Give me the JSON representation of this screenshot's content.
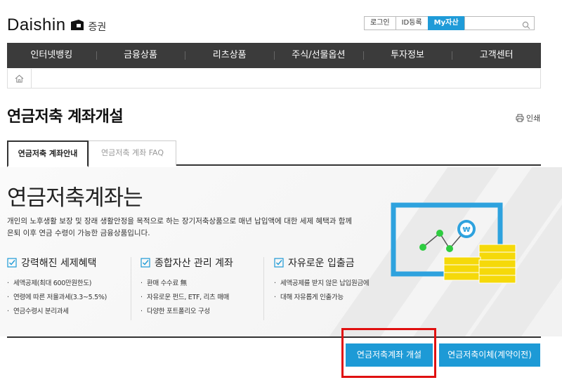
{
  "header": {
    "logo_word": "Daishin",
    "logo_sub": "증권",
    "util": {
      "login": "로그인",
      "id_register": "ID등록",
      "my_asset": "My자산",
      "search_placeholder": ""
    }
  },
  "nav": {
    "items": [
      "인터넷뱅킹",
      "금융상품",
      "리츠상품",
      "주식/선물옵션",
      "투자정보",
      "고객센터"
    ]
  },
  "page": {
    "title": "연금저축 계좌개설",
    "print_label": "인쇄",
    "tabs": [
      {
        "label": "연금저축 계좌안내",
        "active": true
      },
      {
        "label": "연금저축 계좌 FAQ",
        "active": false
      }
    ]
  },
  "hero": {
    "title": "연금저축계좌는",
    "desc_line1": "개인의 노후생활 보장 및 장래 생활안정을 목적으로 하는 장기저축상품으로 매년 납입액에 대한 세제 혜택과 함께",
    "desc_line2": "은퇴 이후 연금 수령이 가능한 금융상품입니다."
  },
  "features": [
    {
      "title": "강력해진 세제혜택",
      "items": [
        "세액공제(최대 600만원한도)",
        "연령에 따른 저율과세(3.3~5.5%)",
        "연금수령시 분리과세"
      ]
    },
    {
      "title": "종합자산 관리 계좌",
      "items": [
        "환매 수수료 無",
        "자유로운 펀드, ETF, 리츠 매매",
        "다양한 포트폴리오 구성"
      ]
    },
    {
      "title": "자유로운 입출금",
      "items": [
        "세액공제를 받지 않은 납입원금에",
        "대해 자유롭게 인출가능"
      ]
    }
  ],
  "buttons": {
    "open": "연금저축계좌 개설",
    "transfer": "연금저축이체(계약이전)"
  },
  "colors": {
    "accent": "#1d9ad6",
    "nav_bg": "#3b3b3b",
    "highlight": "#e01010",
    "coin": "#f5d90a",
    "graph_point": "#2ecc40"
  },
  "icons": {
    "home": "home-icon",
    "search": "search-icon",
    "print": "print-icon",
    "check": "check-icon"
  }
}
